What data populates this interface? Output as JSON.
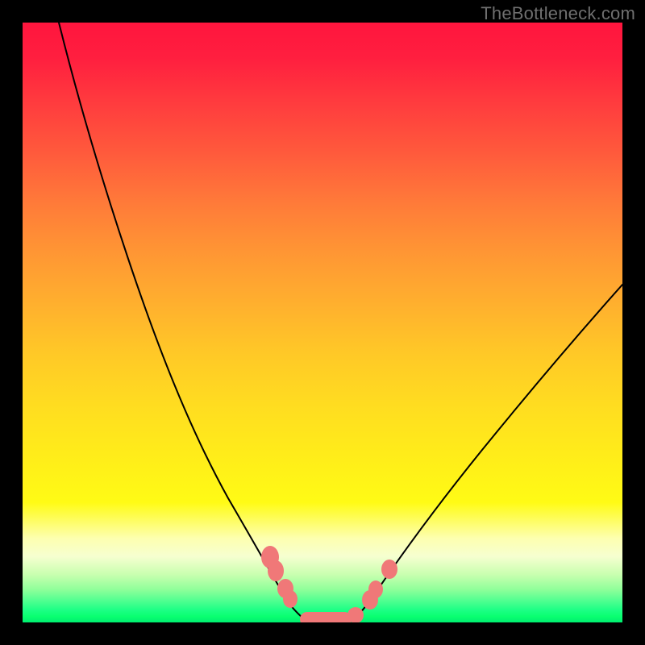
{
  "watermark": "TheBottleneck.com",
  "colors": {
    "bead": "#f07878",
    "curve": "#000000",
    "frame": "#000000"
  },
  "chart_data": {
    "type": "line",
    "title": "",
    "xlabel": "",
    "ylabel": "",
    "xlim": [
      0,
      100
    ],
    "ylim": [
      0,
      100
    ],
    "grid": false,
    "legend": false,
    "background": "red-yellow-green vertical gradient",
    "series": [
      {
        "name": "left-curve",
        "x": [
          6,
          12,
          20,
          28,
          35,
          40,
          44,
          46
        ],
        "values": [
          100,
          78,
          50,
          27,
          12,
          5,
          2,
          1
        ]
      },
      {
        "name": "right-curve",
        "x": [
          56,
          58,
          62,
          68,
          76,
          86,
          96,
          100
        ],
        "values": [
          1,
          2,
          5,
          12,
          24,
          40,
          54,
          60
        ]
      }
    ],
    "markers": [
      {
        "kind": "bead",
        "x": 42,
        "y": 11
      },
      {
        "kind": "bead",
        "x": 42.8,
        "y": 9
      },
      {
        "kind": "bead",
        "x": 44,
        "y": 6
      },
      {
        "kind": "bead",
        "x": 44.3,
        "y": 5
      },
      {
        "kind": "pill",
        "x0": 46,
        "x1": 54,
        "y": 1
      },
      {
        "kind": "bead",
        "x": 55,
        "y": 2
      },
      {
        "kind": "bead",
        "x": 58,
        "y": 4
      },
      {
        "kind": "bead",
        "x": 58.7,
        "y": 5.5
      },
      {
        "kind": "bead",
        "x": 61,
        "y": 9
      }
    ]
  }
}
